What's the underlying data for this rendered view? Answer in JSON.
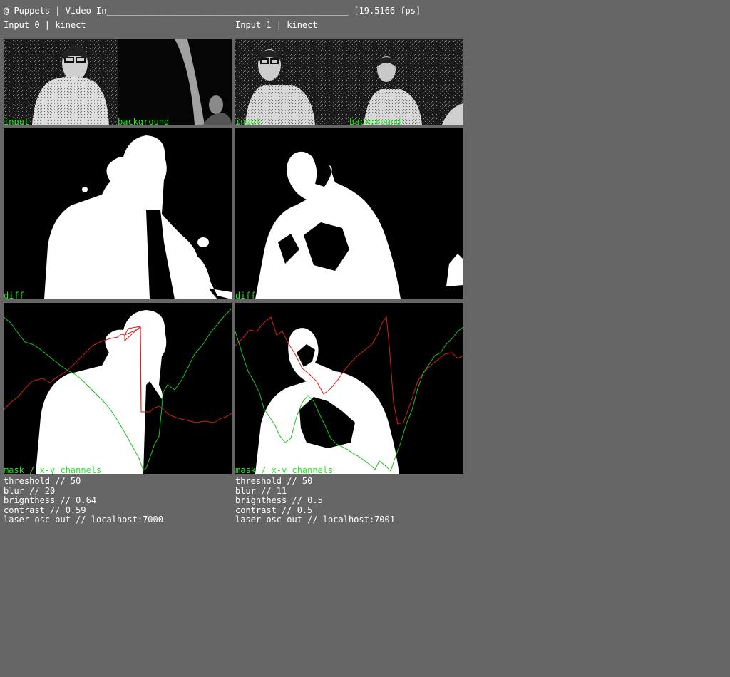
{
  "header": {
    "title": "@ Puppets | Video In",
    "underline": "_______________________________________________",
    "fps": "[19.5166 fps]"
  },
  "inputs": [
    {
      "title": "Input 0 | kinect",
      "labels": {
        "input": "input",
        "background": "background",
        "diff": "diff",
        "mask": "mask / x-y channels"
      },
      "params": [
        "threshold // 50",
        "blur // 20",
        "brignthess // 0.64",
        "contrast // 0.59",
        "laser osc out // localhost:7000"
      ]
    },
    {
      "title": "Input 1 | kinect",
      "labels": {
        "input": "input",
        "background": "background",
        "diff": "diff",
        "mask": "mask / x-y channels"
      },
      "params": [
        "threshold // 50",
        "blur // 11",
        "brignthess // 0.5",
        "contrast // 0.5",
        "laser osc out // localhost:7001"
      ]
    }
  ],
  "colors": {
    "background": "#666666",
    "label_green": "#22e822",
    "channel_x": "#d02020",
    "channel_y": "#20c020"
  }
}
